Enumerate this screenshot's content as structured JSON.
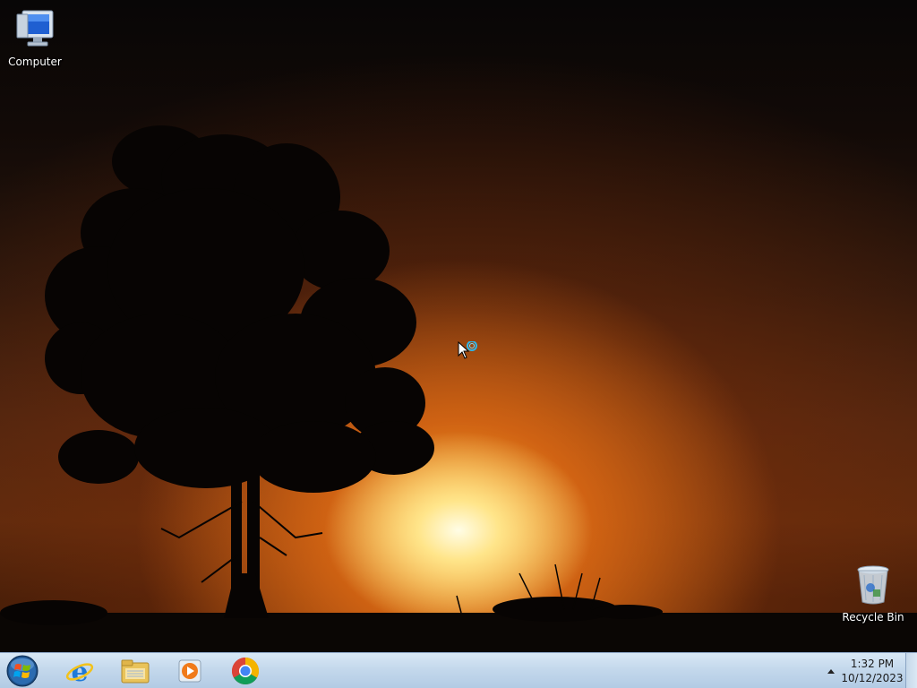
{
  "desktop": {
    "icons": [
      {
        "name": "computer",
        "label": "Computer"
      },
      {
        "name": "recycle-bin",
        "label": "Recycle Bin"
      }
    ]
  },
  "taskbar": {
    "start": {
      "icon": "windows-orb-icon"
    },
    "pinned": [
      {
        "name": "internet-explorer",
        "icon": "internet-explorer-icon"
      },
      {
        "name": "windows-explorer",
        "icon": "folder-icon"
      },
      {
        "name": "media-player",
        "icon": "media-player-icon"
      },
      {
        "name": "chrome",
        "icon": "chrome-icon"
      }
    ],
    "tray": {
      "time": "1:32 PM",
      "date": "10/12/2023"
    }
  },
  "colors": {
    "taskbar": "#c4d8ec",
    "sun": "#ffe58a"
  }
}
